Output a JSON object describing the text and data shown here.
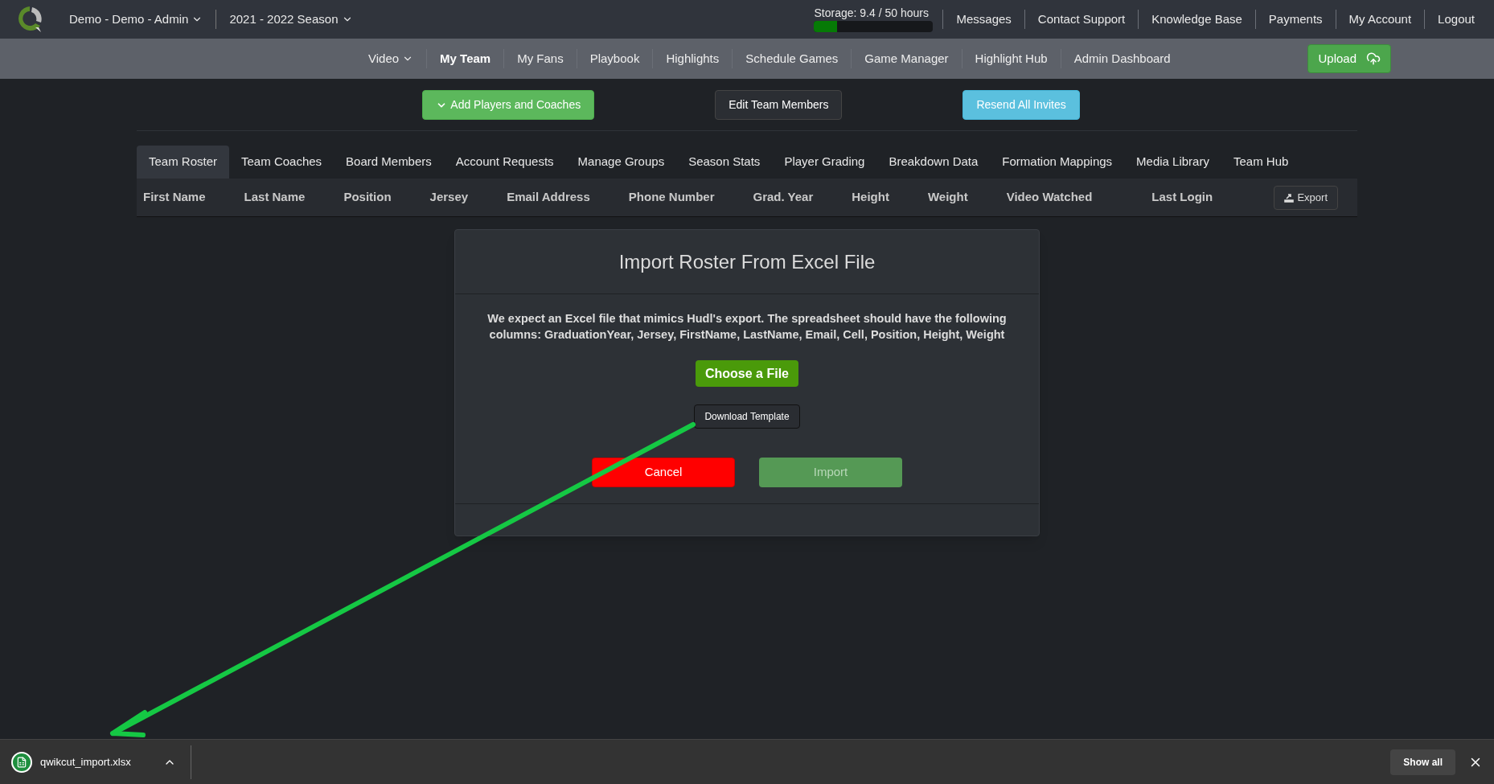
{
  "top_bar": {
    "account": "Demo - Demo - Admin",
    "season": "2021 - 2022 Season",
    "storage": {
      "label": "Storage: 9.4 / 50 hours",
      "level": 0.19
    },
    "links": [
      "Messages",
      "Contact Support",
      "Knowledge Base",
      "Payments",
      "My Account",
      "Logout"
    ]
  },
  "nav": {
    "items": [
      {
        "label": "Video",
        "dropdown": true,
        "selected": false
      },
      {
        "label": "My Team",
        "dropdown": false,
        "selected": true
      },
      {
        "label": "My Fans",
        "dropdown": false,
        "selected": false
      },
      {
        "label": "Playbook",
        "dropdown": false,
        "selected": false
      },
      {
        "label": "Highlights",
        "dropdown": false,
        "selected": false
      },
      {
        "label": "Schedule Games",
        "dropdown": false,
        "selected": false
      },
      {
        "label": "Game Manager",
        "dropdown": false,
        "selected": false
      },
      {
        "label": "Highlight Hub",
        "dropdown": false,
        "selected": false
      },
      {
        "label": "Admin Dashboard",
        "dropdown": false,
        "selected": false
      }
    ],
    "upload": "Upload"
  },
  "actions": [
    {
      "label": "Add Players and Coaches",
      "kind": "add"
    },
    {
      "label": "Edit Team Members",
      "kind": "dark"
    },
    {
      "label": "Resend All Invites",
      "kind": "info"
    }
  ],
  "tabs": [
    {
      "label": "Team Roster",
      "selected": true
    },
    {
      "label": "Team Coaches",
      "selected": false
    },
    {
      "label": "Board Members",
      "selected": false
    },
    {
      "label": "Account Requests",
      "selected": false
    },
    {
      "label": "Manage Groups",
      "selected": false
    },
    {
      "label": "Season Stats",
      "selected": false
    },
    {
      "label": "Player Grading",
      "selected": false
    },
    {
      "label": "Breakdown Data",
      "selected": false
    },
    {
      "label": "Formation Mappings",
      "selected": false
    },
    {
      "label": "Media Library",
      "selected": false
    },
    {
      "label": "Team Hub",
      "selected": false
    }
  ],
  "table": {
    "columns": [
      "First Name",
      "Last Name",
      "Position",
      "Jersey",
      "Email Address",
      "Phone Number",
      "Grad. Year",
      "Height",
      "Weight",
      "Video Watched",
      "Last Login"
    ],
    "export": "Export"
  },
  "modal": {
    "title": "Import Roster From Excel File",
    "message": "We expect an Excel file that mimics Hudl's export. The spreadsheet should have the following columns: GraduationYear, Jersey, FirstName, LastName, Email, Cell, Position, Height, Weight",
    "choose": "Choose a File",
    "template": "Download Template",
    "cancel": "Cancel",
    "import": "Import"
  },
  "download_bar": {
    "file": "qwikcut_import.xlsx",
    "show_all": "Show all"
  }
}
